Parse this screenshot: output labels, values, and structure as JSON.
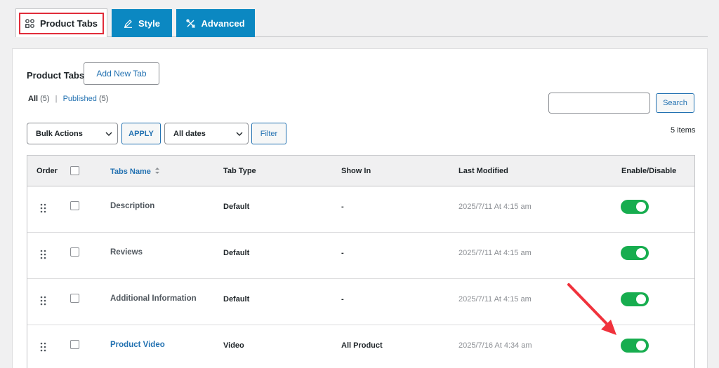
{
  "tabs": [
    {
      "label": "Product Tabs",
      "icon": "apps-grid-icon",
      "active": true
    },
    {
      "label": "Style",
      "icon": "pen-icon",
      "active": false
    },
    {
      "label": "Advanced",
      "icon": "tools-icon",
      "active": false
    }
  ],
  "page": {
    "title": "Product Tabs",
    "add_new_label": "Add New Tab"
  },
  "filters_links": {
    "all_label": "All",
    "all_count": "(5)",
    "separator": "|",
    "published_label": "Published",
    "published_count": "(5)"
  },
  "search": {
    "placeholder": "",
    "button_label": "Search"
  },
  "bulk": {
    "selected": "Bulk Actions",
    "apply_label": "APPLY"
  },
  "dates": {
    "selected": "All dates",
    "filter_label": "Filter"
  },
  "item_count": "5 items",
  "table": {
    "headers": {
      "order": "Order",
      "name": "Tabs Name",
      "type": "Tab Type",
      "show_in": "Show In",
      "modified": "Last Modified",
      "enable": "Enable/Disable"
    },
    "rows": [
      {
        "name": "Description",
        "type": "Default",
        "show_in": "-",
        "modified": "2025/7/11 At 4:15 am",
        "enabled": true,
        "is_link": false
      },
      {
        "name": "Reviews",
        "type": "Default",
        "show_in": "-",
        "modified": "2025/7/11 At 4:15 am",
        "enabled": true,
        "is_link": false
      },
      {
        "name": "Additional Information",
        "type": "Default",
        "show_in": "-",
        "modified": "2025/7/11 At 4:15 am",
        "enabled": true,
        "is_link": false
      },
      {
        "name": "Product Video",
        "type": "Video",
        "show_in": "All Product",
        "modified": "2025/7/16 At 4:34 am",
        "enabled": true,
        "is_link": true
      }
    ]
  },
  "colors": {
    "accent_blue": "#0b88c2",
    "link_blue": "#2271b1",
    "toggle_on": "#17ad4f",
    "highlight_red": "#e12c3a",
    "arrow_red": "#f0323c"
  }
}
